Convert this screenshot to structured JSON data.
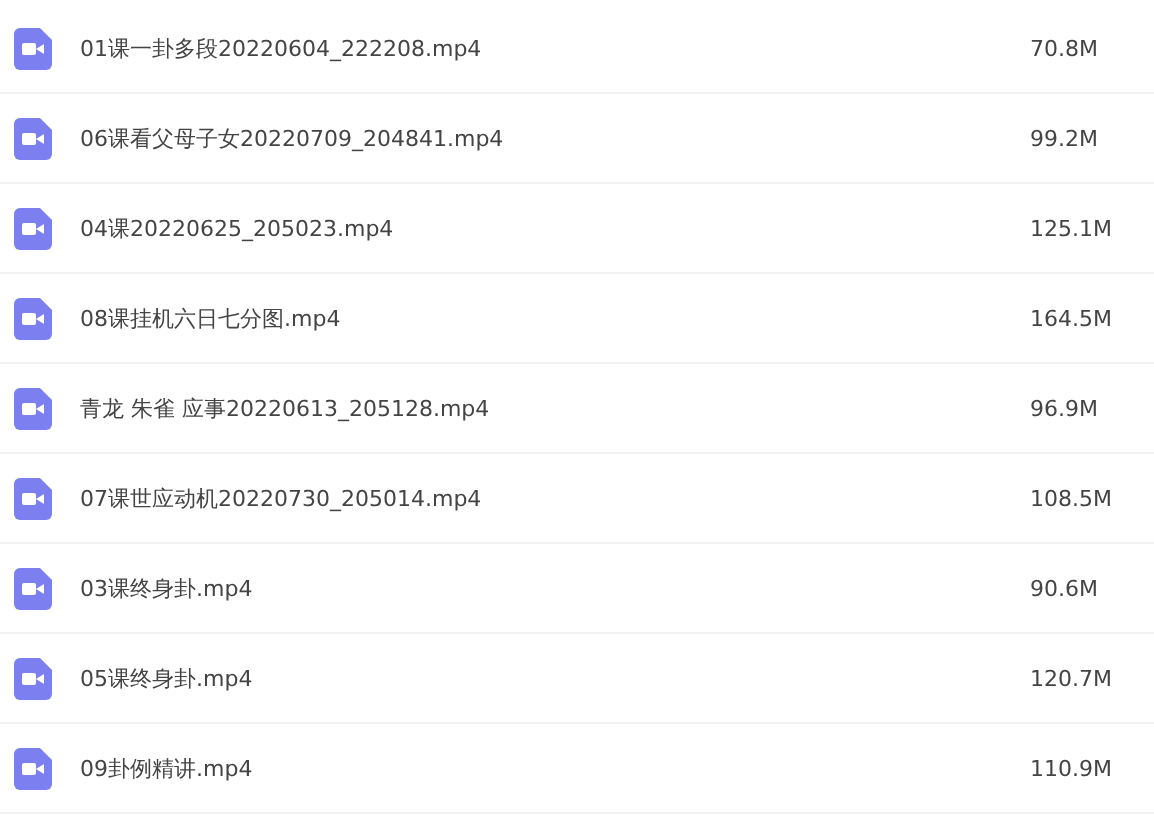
{
  "files": [
    {
      "name": "01课一卦多段20220604_222208.mp4",
      "size": "70.8M"
    },
    {
      "name": "06课看父母子女20220709_204841.mp4",
      "size": "99.2M"
    },
    {
      "name": "04课20220625_205023.mp4",
      "size": "125.1M"
    },
    {
      "name": "08课挂机六日七分图.mp4",
      "size": "164.5M"
    },
    {
      "name": "青龙 朱雀 应事20220613_205128.mp4",
      "size": "96.9M"
    },
    {
      "name": "07课世应动机20220730_205014.mp4",
      "size": "108.5M"
    },
    {
      "name": "03课终身卦.mp4",
      "size": "90.6M"
    },
    {
      "name": "05课终身卦.mp4",
      "size": "120.7M"
    },
    {
      "name": "09卦例精讲.mp4",
      "size": "110.9M"
    }
  ]
}
